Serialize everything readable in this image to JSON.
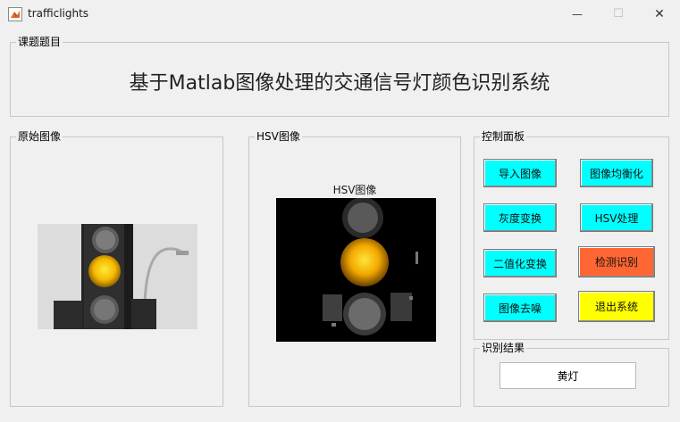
{
  "window": {
    "title": "trafficlights",
    "minimize": "—",
    "maximize": "☐",
    "close": "✕"
  },
  "panels": {
    "topic": {
      "legend": "课题题目",
      "title": "基于Matlab图像处理的交通信号灯颜色识别系统"
    },
    "original": {
      "legend": "原始图像"
    },
    "hsv": {
      "legend": "HSV图像",
      "axes_title": "HSV图像"
    },
    "control": {
      "legend": "控制面板"
    },
    "result": {
      "legend": "识别结果",
      "value": "黄灯"
    }
  },
  "buttons": [
    {
      "id": "import",
      "label": "导入图像",
      "color": "#00ffff"
    },
    {
      "id": "equalize",
      "label": "图像均衡化",
      "color": "#00ffff"
    },
    {
      "id": "gray",
      "label": "灰度变换",
      "color": "#00ffff"
    },
    {
      "id": "hsv",
      "label": "HSV处理",
      "color": "#00ffff"
    },
    {
      "id": "binarize",
      "label": "二值化变换",
      "color": "#00ffff"
    },
    {
      "id": "detect",
      "label": "检测识别",
      "color": "#ff6633"
    },
    {
      "id": "denoise",
      "label": "图像去噪",
      "color": "#00ffff"
    },
    {
      "id": "exit",
      "label": "退出系统",
      "color": "#ffff00"
    }
  ]
}
